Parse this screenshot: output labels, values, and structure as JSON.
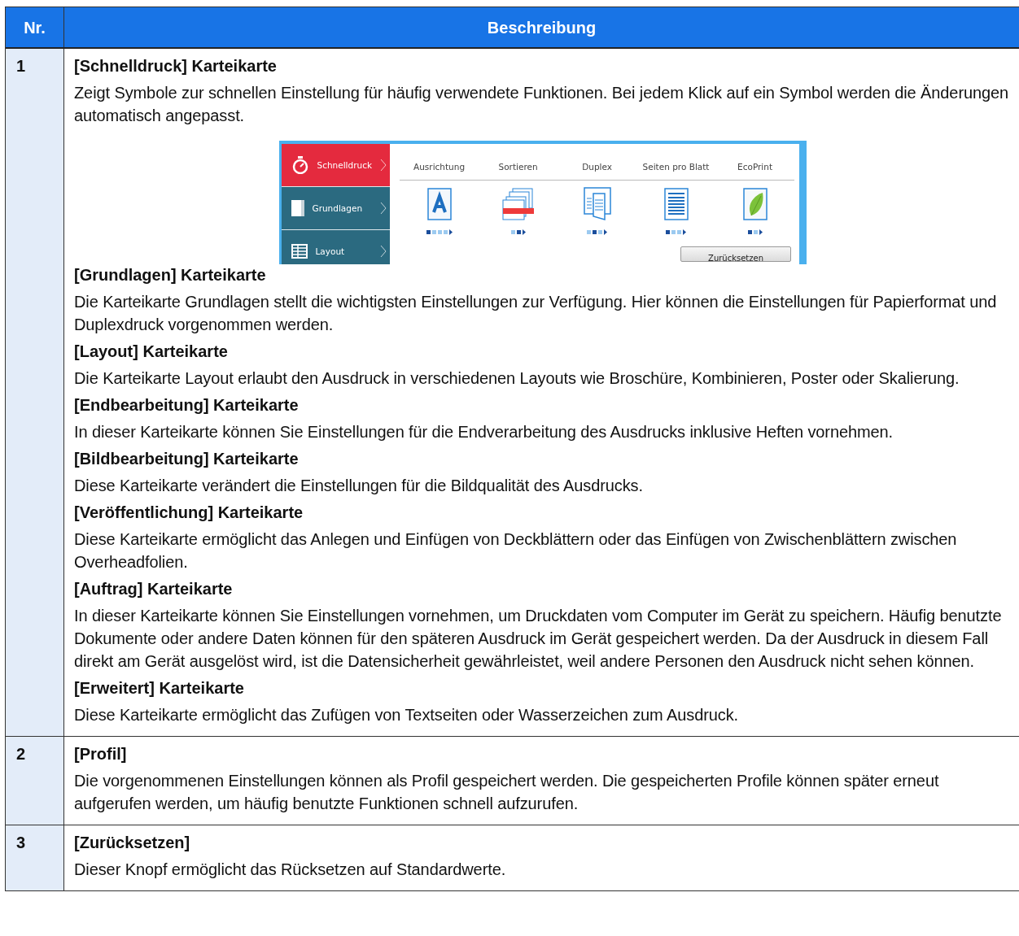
{
  "table": {
    "columns": [
      "Nr.",
      "Beschreibung"
    ],
    "rows": [
      {
        "nr": "1",
        "sections": [
          {
            "title": "[Schnelldruck] Karteikarte",
            "text": "Zeigt Symbole zur schnellen Einstellung für häufig verwendete Funktionen. Bei jedem Klick auf ein Symbol werden die Änderungen automatisch angepasst.",
            "screenshot": {
              "tabs": [
                {
                  "label": "Schnelldruck",
                  "kind": "timer",
                  "selected": true
                },
                {
                  "label": "Grundlagen",
                  "kind": "book",
                  "selected": false
                },
                {
                  "label": "Layout",
                  "kind": "grid",
                  "selected": false
                }
              ],
              "settings": [
                {
                  "label": "Ausrichtung",
                  "kind": "letter",
                  "options": [
                    {
                      "selected": true
                    },
                    {
                      "selected": false
                    },
                    {
                      "selected": false
                    },
                    {
                      "selected": false
                    }
                  ]
                },
                {
                  "label": "Sortieren",
                  "kind": "collate",
                  "options": [
                    {
                      "selected": false
                    },
                    {
                      "selected": true
                    }
                  ]
                },
                {
                  "label": "Duplex",
                  "kind": "duplex",
                  "options": [
                    {
                      "selected": false
                    },
                    {
                      "selected": true
                    },
                    {
                      "selected": false
                    }
                  ]
                },
                {
                  "label": "Seiten pro Blatt",
                  "kind": "page",
                  "options": [
                    {
                      "selected": true
                    },
                    {
                      "selected": false
                    },
                    {
                      "selected": false
                    }
                  ]
                },
                {
                  "label": "EcoPrint",
                  "kind": "leaf",
                  "options": [
                    {
                      "selected": true
                    },
                    {
                      "selected": false
                    }
                  ]
                }
              ],
              "reset_button": "Zurücksetzen"
            }
          },
          {
            "title": "[Grundlagen] Karteikarte",
            "text": "Die Karteikarte Grundlagen stellt die wichtigsten Einstellungen zur Verfügung. Hier können die Einstellungen für Papierformat und Duplexdruck vorgenommen werden."
          },
          {
            "title": "[Layout] Karteikarte",
            "text": "Die Karteikarte Layout erlaubt den Ausdruck in verschiedenen Layouts wie Broschüre, Kombinieren, Poster oder Skalierung."
          },
          {
            "title": "[Endbearbeitung] Karteikarte",
            "text": "In dieser Karteikarte können Sie Einstellungen für die Endverarbeitung des Ausdrucks inklusive Heften vornehmen."
          },
          {
            "title": "[Bildbearbeitung] Karteikarte",
            "text": "Diese Karteikarte verändert die Einstellungen für die Bildqualität des Ausdrucks."
          },
          {
            "title": "[Veröffentlichung] Karteikarte",
            "text": "Diese Karteikarte ermöglicht das Anlegen und Einfügen von Deckblättern oder das Einfügen von Zwischenblättern zwischen Overheadfolien."
          },
          {
            "title": "[Auftrag] Karteikarte",
            "text": "In dieser Karteikarte können Sie Einstellungen vornehmen, um Druckdaten vom Computer im Gerät zu speichern. Häufig benutzte Dokumente oder andere Daten können für den späteren Ausdruck im Gerät gespeichert werden. Da der Ausdruck in diesem Fall direkt am Gerät ausgelöst wird, ist die Datensicherheit gewährleistet, weil andere Personen den Ausdruck nicht sehen können."
          },
          {
            "title": "[Erweitert] Karteikarte",
            "text": "Diese Karteikarte ermöglicht das Zufügen von Textseiten oder Wasserzeichen zum Ausdruck."
          }
        ]
      },
      {
        "nr": "2",
        "sections": [
          {
            "title": "[Profil]",
            "text": "Die vorgenommenen Einstellungen können als Profil gespeichert werden. Die gespeicherten Profile können später erneut aufgerufen werden, um häufig benutzte Funktionen schnell aufzurufen."
          }
        ]
      },
      {
        "nr": "3",
        "sections": [
          {
            "title": "[Zurücksetzen]",
            "text": "Dieser Knopf ermöglicht das Rücksetzen auf Standardwerte."
          }
        ]
      }
    ]
  }
}
